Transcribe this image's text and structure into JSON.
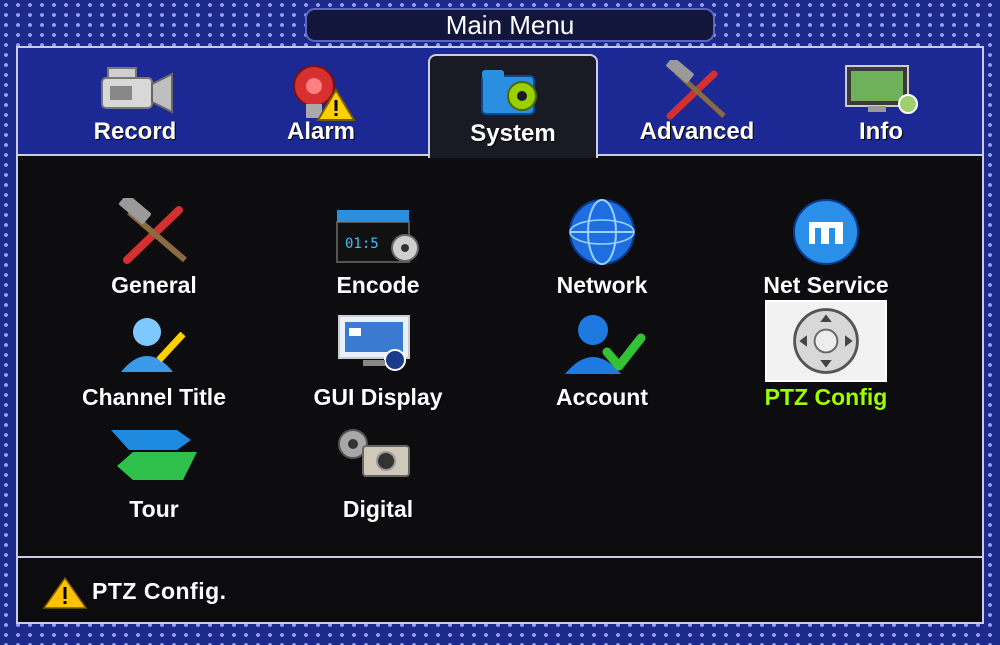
{
  "window": {
    "title": "Main Menu"
  },
  "tabs": [
    {
      "label": "Record",
      "icon": "camcorder-icon"
    },
    {
      "label": "Alarm",
      "icon": "alarm-bell-icon"
    },
    {
      "label": "System",
      "icon": "folder-gear-icon",
      "active": true
    },
    {
      "label": "Advanced",
      "icon": "hammer-screwdriver-icon"
    },
    {
      "label": "Info",
      "icon": "monitor-info-icon"
    }
  ],
  "items": [
    {
      "label": "General",
      "icon": "hammer-screwdriver-icon"
    },
    {
      "label": "Encode",
      "icon": "clapperboard-gear-icon"
    },
    {
      "label": "Network",
      "icon": "globe-icon"
    },
    {
      "label": "Net Service",
      "icon": "net-service-globe-icon"
    },
    {
      "label": "Channel Title",
      "icon": "user-pencil-icon"
    },
    {
      "label": "GUI Display",
      "icon": "display-screens-icon"
    },
    {
      "label": "Account",
      "icon": "user-check-icon"
    },
    {
      "label": "PTZ Config",
      "icon": "ptz-joystick-icon",
      "selected": true
    },
    {
      "label": "Tour",
      "icon": "tour-arrows-icon"
    },
    {
      "label": "Digital",
      "icon": "digital-camera-gear-icon"
    }
  ],
  "status": {
    "text": "PTZ Config.",
    "icon": "warning-icon"
  },
  "colors": {
    "frame": "#1e2a8a",
    "selected_label": "#9cff00",
    "panel": "#0c0c0e"
  }
}
